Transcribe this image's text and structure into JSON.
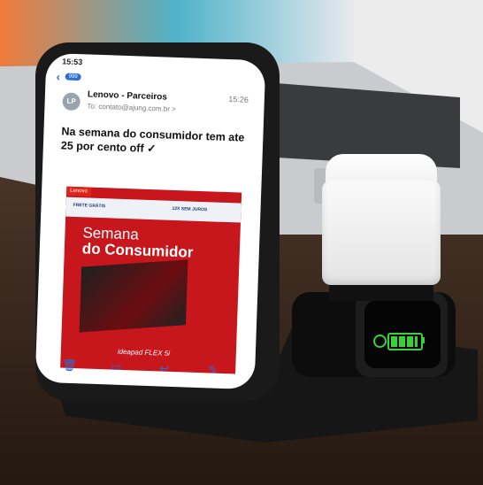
{
  "scene": {
    "colors": {
      "dock": "#121212",
      "table": "#3b2a1f",
      "battery": "#39d039",
      "lenovo_red": "#c8161d"
    }
  },
  "phone": {
    "status_time": "15:53",
    "inbox_badge": "999",
    "email": {
      "avatar_initials": "LP",
      "sender": "Lenovo - Parceiros",
      "time": "15:26",
      "to": "To: contato@ajung.com.br >",
      "subject": "Na semana do consumidor tem ate 25 por cento off ✓",
      "banner": {
        "logo": "Lenovo",
        "strip_left": "FRETE GRÁTIS",
        "strip_right": "12X SEM JUROS",
        "headline_1": "Semana",
        "headline_2": "do Consumidor",
        "product": "ideapad FLEX 5i"
      }
    },
    "toolbar": [
      "trash-icon",
      "folder-icon",
      "reply-icon",
      "compose-icon"
    ]
  },
  "watch": {
    "battery_level": 1.0,
    "icons": [
      "power-icon",
      "battery-icon"
    ]
  }
}
